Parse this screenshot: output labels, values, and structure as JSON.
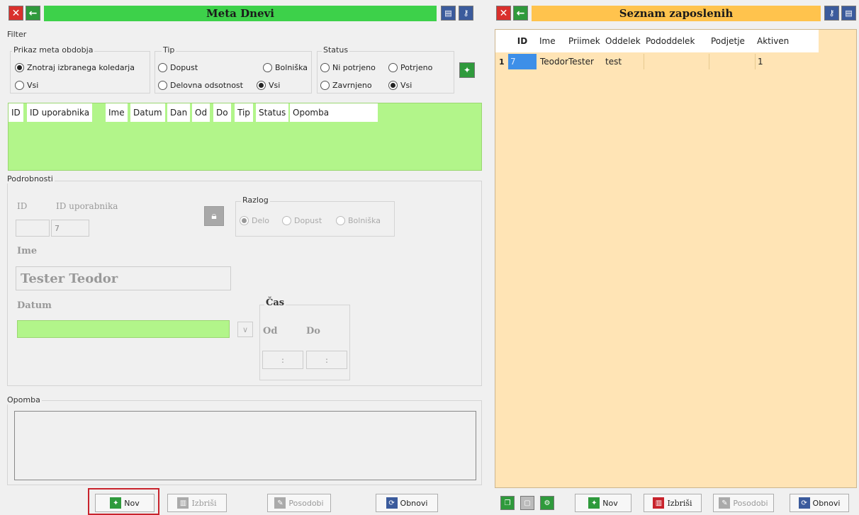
{
  "left": {
    "title": "Meta Dnevi",
    "close_icon": "✕",
    "back_icon": "←",
    "filter": {
      "label": "Filter",
      "period_group": "Prikaz meta obdobja",
      "period_opts": [
        "Znotraj izbranega koledarja",
        "Vsi"
      ],
      "type_group": "Tip",
      "type_opts": [
        "Dopust",
        "Bolniška",
        "Delovna odsotnost",
        "Vsi"
      ],
      "status_group": "Status",
      "status_opts": [
        "Ni potrjeno",
        "Potrjeno",
        "Zavrnjeno",
        "Vsi"
      ]
    },
    "table_columns": [
      "ID",
      "ID uporabnika",
      "Ime",
      "Datum",
      "Dan",
      "Od",
      "Do",
      "Tip",
      "Status",
      "Opomba"
    ],
    "details": {
      "label": "Podrobnosti",
      "id_label": "ID",
      "user_id_label": "ID uporabnika",
      "id_value": "",
      "user_id_value": "7",
      "reason_label": "Razlog",
      "reason_opts": [
        "Delo",
        "Dopust",
        "Bolniška"
      ],
      "name_label": "Ime",
      "name_value": "Tester Teodor",
      "date_label": "Datum",
      "time_label": "Čas",
      "from_label": "Od",
      "to_label": "Do",
      "time_sep": ":"
    },
    "note_label": "Opomba",
    "buttons": {
      "new": "Nov",
      "delete": "Izbriši",
      "update": "Posodobi",
      "refresh": "Obnovi"
    }
  },
  "right": {
    "title": "Seznam zaposlenih",
    "columns": [
      "ID",
      "Ime",
      "Priimek",
      "Oddelek",
      "Pododdelek",
      "Podjetje",
      "Aktiven"
    ],
    "rows": [
      {
        "num": "1",
        "id": "7",
        "ime": "Teodor",
        "priimek": "Tester",
        "oddelek": "test",
        "pododdelek": "",
        "podjetje": "",
        "aktiven": "1"
      }
    ],
    "buttons": {
      "new": "Nov",
      "delete": "Izbriši",
      "update": "Posodobi",
      "refresh": "Obnovi"
    }
  },
  "colors": {
    "left_title_bg": "#3dd14a",
    "right_title_bg": "#ffc34d",
    "table_green": "#b2f58a",
    "right_bg": "#ffe4b5",
    "highlight": "#c8232c"
  }
}
